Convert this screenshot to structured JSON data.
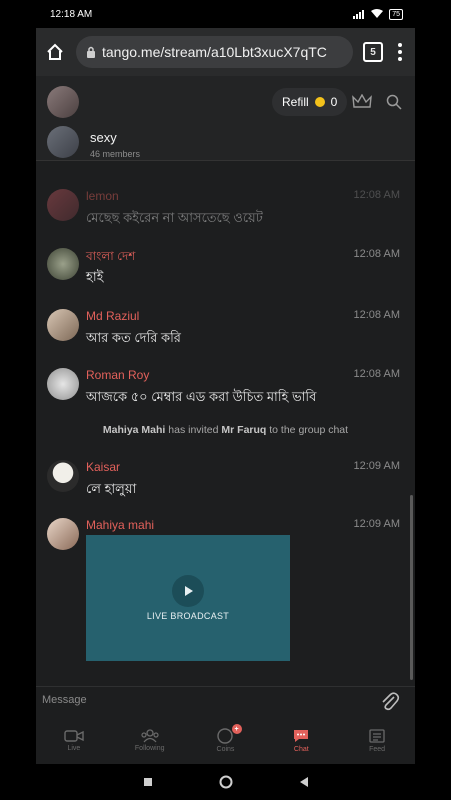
{
  "status_bar": {
    "time": "12:18 AM",
    "battery": "75"
  },
  "browser": {
    "url": "tango.me/stream/a10Lbt3xucX7qTC",
    "tab_count": "5"
  },
  "chat_header": {
    "refill_label": "Refill",
    "coin_count": "0",
    "group_name": "sexy",
    "members": "46 members"
  },
  "messages": [
    {
      "name": "lemon",
      "time": "12:08 AM",
      "text": "মেছেছ কইরেন না আসতেছে ওয়েট"
    },
    {
      "name": "বাংলা দেশ",
      "time": "12:08 AM",
      "text": "হাই"
    },
    {
      "name": "Md Raziul",
      "time": "12:08 AM",
      "text": "আর কত দেরি করি"
    },
    {
      "name": "Roman Roy",
      "time": "12:08 AM",
      "text": "আজকে ৫০ মেম্বার এড করা উচিত মাহি ভাবি"
    },
    {
      "name": "Kaisar",
      "time": "12:09 AM",
      "text": "লে হালুয়া"
    },
    {
      "name": "Mahiya mahi",
      "time": "12:09 AM",
      "text": ""
    }
  ],
  "system_message": {
    "actor": "Mahiya Mahi",
    "action": "has invited",
    "target": "Mr Faruq",
    "suffix": "to the group chat"
  },
  "broadcast": {
    "label": "LIVE BROADCAST"
  },
  "input": {
    "placeholder": "Message"
  },
  "bottom_nav": [
    {
      "label": "Live",
      "icon": "video-camera-icon"
    },
    {
      "label": "Following",
      "icon": "people-icon"
    },
    {
      "label": "Coins",
      "icon": "coin-icon",
      "badge": "+"
    },
    {
      "label": "Chat",
      "icon": "chat-bubble-icon",
      "active": true
    },
    {
      "label": "Feed",
      "icon": "news-feed-icon"
    }
  ],
  "colors": {
    "accent": "#e2615b",
    "background": "#1d1e1f",
    "broadcast_tile": "#26616e",
    "coin": "#f4c21b"
  }
}
